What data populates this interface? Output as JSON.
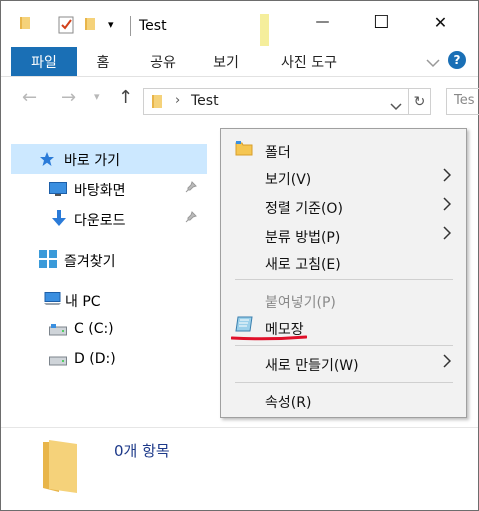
{
  "window": {
    "title": "Test"
  },
  "window_controls": {
    "minimize": "—",
    "maximize": "☐",
    "close": "✕"
  },
  "ribbon": {
    "tabs": [
      {
        "label": "파일"
      },
      {
        "label": "홈"
      },
      {
        "label": "공유"
      },
      {
        "label": "보기"
      },
      {
        "label": "사진 도구"
      }
    ],
    "help_label": "?"
  },
  "address": {
    "path": "Test",
    "search_placeholder": "Tes"
  },
  "sidebar": {
    "items": [
      {
        "label": "바로 가기",
        "icon": "star-icon"
      },
      {
        "label": "바탕화면",
        "icon": "desktop-icon"
      },
      {
        "label": "다운로드",
        "icon": "download-icon"
      },
      {
        "label": "즐겨찾기",
        "icon": "favorites-icon"
      },
      {
        "label": "내 PC",
        "icon": "pc-icon"
      },
      {
        "label": "C (C:)",
        "icon": "drive-icon"
      },
      {
        "label": "D (D:)",
        "icon": "drive-icon"
      }
    ]
  },
  "context_menu": {
    "items": [
      {
        "label": "폴더"
      },
      {
        "label": "보기(V)"
      },
      {
        "label": "정렬 기준(O)"
      },
      {
        "label": "분류 방법(P)"
      },
      {
        "label": "새로 고침(E)"
      },
      {
        "label": "붙여넣기(P)"
      },
      {
        "label": "메모장"
      },
      {
        "label": "새로 만들기(W)"
      },
      {
        "label": "속성(R)"
      }
    ]
  },
  "details": {
    "item_count": "0개 항목"
  },
  "colors": {
    "accent": "#1a6fb5",
    "selected": "#cce8ff",
    "highlight_red": "#e0102a",
    "folder": "#f5c652"
  }
}
